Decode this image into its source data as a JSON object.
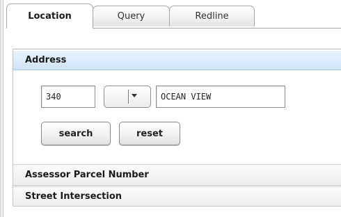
{
  "tabs": [
    {
      "label": "Location",
      "active": true
    },
    {
      "label": "Query",
      "active": false
    },
    {
      "label": "Redline",
      "active": false
    }
  ],
  "address": {
    "header": "Address",
    "house_number": "340",
    "direction": "",
    "street_name": "OCEAN VIEW",
    "search_label": "search",
    "reset_label": "reset"
  },
  "sections": {
    "apn": "Assessor Parcel Number",
    "intersection": "Street Intersection"
  },
  "colors": {
    "active_header": "#cfe5f8",
    "border": "#a8a8a8"
  }
}
